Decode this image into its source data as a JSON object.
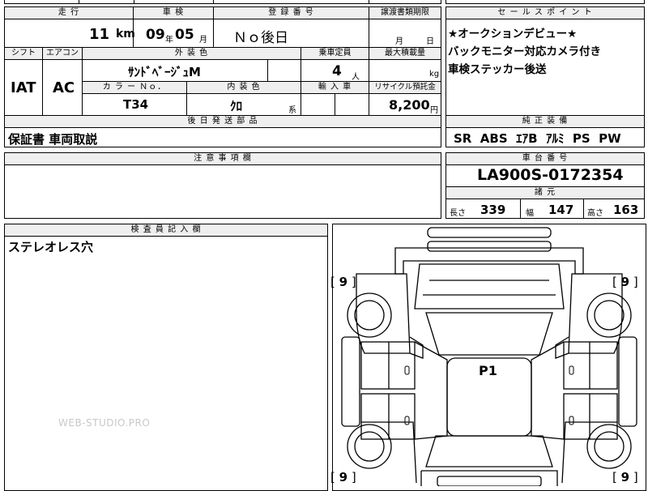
{
  "sheet": {
    "mileage": {
      "header": "走 行",
      "value": "11",
      "unit": "km"
    },
    "inspection": {
      "header": "車 検",
      "year": "09",
      "year_unit": "年",
      "month": "05",
      "month_unit": "月"
    },
    "registration": {
      "header": "登 録 番 号",
      "value": "Ｎｏ後日"
    },
    "transfer": {
      "header": "譲渡書類期限",
      "month_unit": "月",
      "day_unit": "日"
    },
    "shift": {
      "header": "シフト",
      "value": "IAT"
    },
    "aircon": {
      "header": "エアコン",
      "value": "AC"
    },
    "exterior_color": {
      "header": "外 装 色",
      "value": "ｻﾝﾄﾞﾍﾞｰｼﾞｭM"
    },
    "capacity": {
      "header": "乗車定員",
      "value": "4",
      "unit": "人"
    },
    "max_load": {
      "header": "最大積載量",
      "unit": "kg"
    },
    "color_no": {
      "header": "カ ラ ー Ｎｏ．",
      "value": "T34"
    },
    "interior_color": {
      "header": "内 装 色",
      "value": "ｸﾛ",
      "unit": "系"
    },
    "import": {
      "header": "輸 入 車"
    },
    "recycle": {
      "header": "リサイクル預託金",
      "value": "8,200",
      "unit": "円"
    },
    "later_parts": {
      "header": "後 日 発 送 部 品",
      "value": "保証書 車両取説"
    },
    "notes": {
      "header": "注 意 事 項 欄"
    },
    "inspector": {
      "header": "検 査 員 記 入 欄",
      "value": "ステレオレス穴"
    },
    "sales_point": {
      "header": "セ ー ル ス ポ イ ン ト",
      "lines": [
        "★オークションデビュー★",
        "バックモニター対応カメラ付き",
        "車検ステッカー後送"
      ]
    },
    "equipment": {
      "header": "純 正 装 備",
      "value": "SR  ABS  ｴｱB  ｱﾙﾐ  PS  PW"
    },
    "chassis": {
      "header": "車 台 番 号",
      "value": "LA900S-0172354"
    },
    "specs": {
      "header": "諸 元",
      "length_label": "長さ",
      "length": "339",
      "width_label": "幅",
      "width": "147",
      "height_label": "高さ",
      "height": "163"
    }
  },
  "diagram": {
    "tire_marks": [
      "9",
      "9",
      "9",
      "9"
    ],
    "roof_mark": "P1"
  },
  "watermark": "WEB-STUDIO.PRO"
}
